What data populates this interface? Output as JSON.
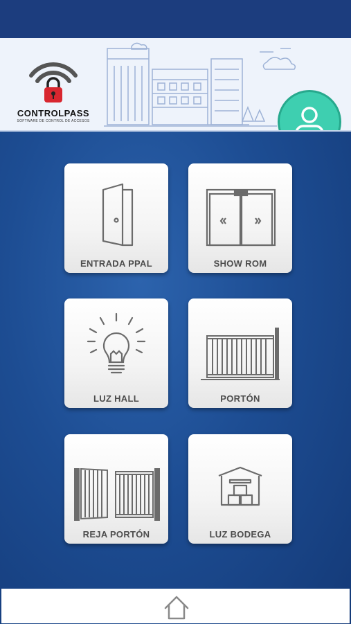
{
  "app": {
    "logo_text": "CONTROLPASS",
    "logo_subtitle": "SOFTWARE DE CONTROL DE ACCESOS"
  },
  "header": {
    "avatar_icon": "user-profile-icon"
  },
  "tiles": [
    {
      "label": "ENTRADA PPAL",
      "icon": "door-icon"
    },
    {
      "label": "SHOW ROM",
      "icon": "sliding-door-icon"
    },
    {
      "label": "LUZ HALL",
      "icon": "light-bulb-icon"
    },
    {
      "label": "PORTÓN",
      "icon": "sliding-gate-icon"
    },
    {
      "label": "REJA PORTÓN",
      "icon": "swing-gate-icon"
    },
    {
      "label": "LUZ BODEGA",
      "icon": "warehouse-icon"
    }
  ],
  "nav": {
    "home_icon": "home-icon"
  },
  "colors": {
    "background": "#1d4d93",
    "accent": "#3ecfb0",
    "tile_label": "#4d4d4d"
  }
}
